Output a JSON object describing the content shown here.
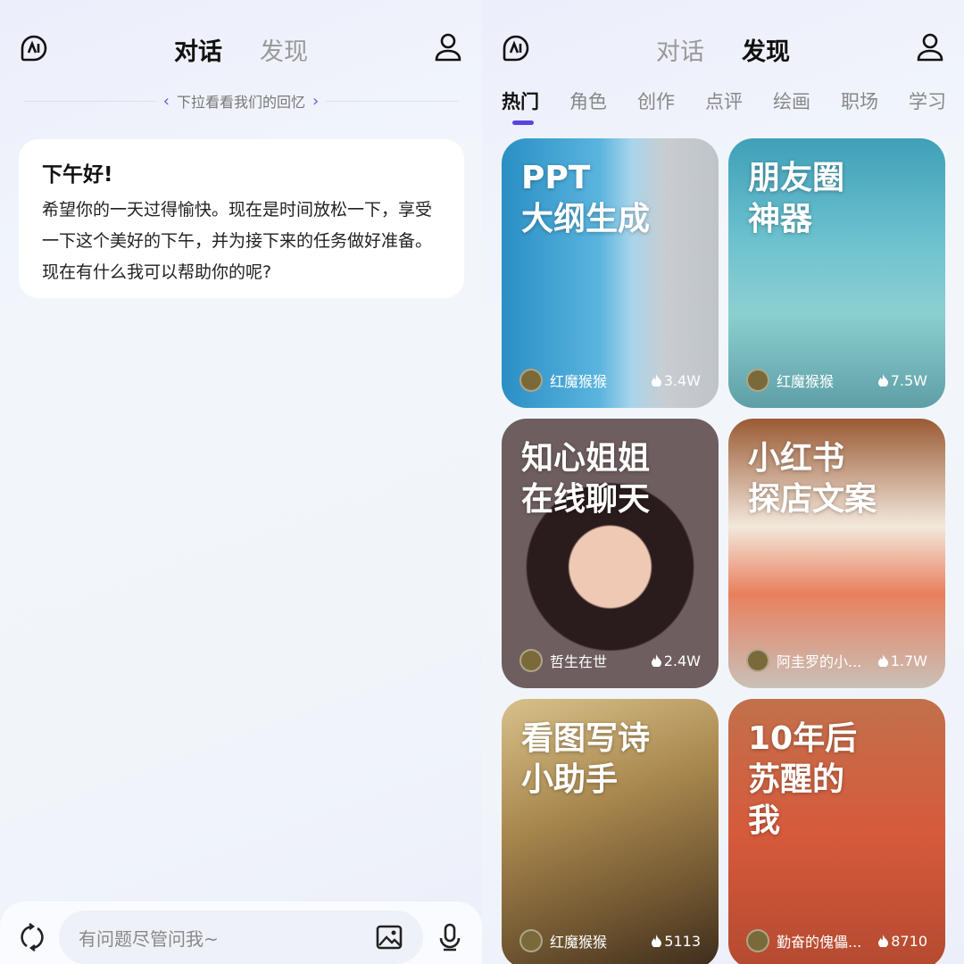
{
  "header": {
    "tabs": [
      "对话",
      "发现"
    ]
  },
  "chat": {
    "hint": "下拉看看我们的回忆",
    "greeting": "下午好!",
    "message": "希望你的一天过得愉快。现在是时间放松一下，享受一下这个美好的下午，并为接下来的任务做好准备。现在有什么我可以帮助你的呢?",
    "input_placeholder": "有问题尽管问我~"
  },
  "discover": {
    "categories": [
      "热门",
      "角色",
      "创作",
      "点评",
      "绘画",
      "职场",
      "学习"
    ],
    "cards": [
      {
        "title": "PPT\n大纲生成",
        "author": "红魔猴猴",
        "count": "3.4W"
      },
      {
        "title": "朋友圈\n神器",
        "author": "红魔猴猴",
        "count": "7.5W"
      },
      {
        "title": "知心姐姐\n在线聊天",
        "author": "哲生在世",
        "count": "2.4W"
      },
      {
        "title": "小红书\n探店文案",
        "author": "阿圭罗的小...",
        "count": "1.7W"
      },
      {
        "title": "看图写诗\n小助手",
        "author": "红魔猴猴",
        "count": "5113"
      },
      {
        "title": "10年后\n苏醒的\n我",
        "author": "勤奋的傀儡...",
        "count": "8710"
      }
    ]
  },
  "colors": {
    "accent": "#5a45e0"
  }
}
